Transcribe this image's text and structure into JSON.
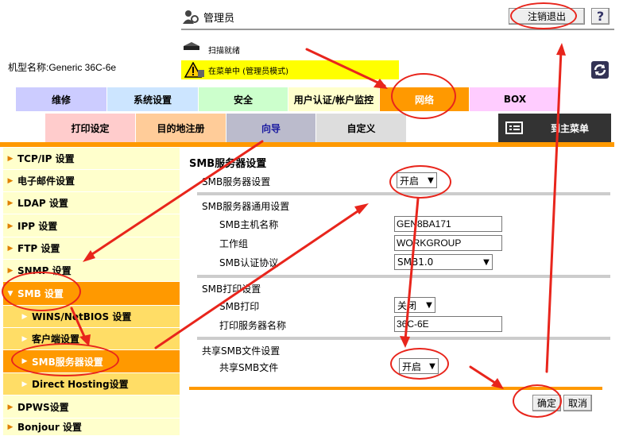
{
  "header": {
    "admin_label": "管理员",
    "scan_status": "扫描就绪",
    "model_label": "机型名称:Generic 36C-6e",
    "warning_text": "在菜单中 (管理员模式)",
    "logout_label": "注销退出",
    "help_label": "?"
  },
  "tabs": [
    {
      "label": "维修",
      "color": "#ccccff"
    },
    {
      "label": "系统设置",
      "color": "#cce5ff"
    },
    {
      "label": "安全",
      "color": "#ccffcc"
    },
    {
      "label": "用户认证/帐户监控",
      "color": "#ffffcc"
    },
    {
      "label": "网络",
      "color": "#ff9900"
    },
    {
      "label": "BOX",
      "color": "#ffccff"
    }
  ],
  "subtabs": [
    {
      "label": "打印设定",
      "color": "#ffcccc"
    },
    {
      "label": "目的地注册",
      "color": "#ffcc99"
    },
    {
      "label": "向导",
      "color": "#bbbbcc"
    },
    {
      "label": "自定义",
      "color": "#dddddd"
    },
    {
      "label": "到主菜单",
      "color": "#333333"
    }
  ],
  "sidebar": [
    {
      "label": "TCP/IP 设置"
    },
    {
      "label": "电子邮件设置"
    },
    {
      "label": "LDAP 设置"
    },
    {
      "label": "IPP 设置"
    },
    {
      "label": "FTP 设置"
    },
    {
      "label": "SNMP 设置"
    },
    {
      "label": "SMB 设置"
    },
    {
      "label": "WINS/NetBIOS 设置"
    },
    {
      "label": "客户端设置"
    },
    {
      "label": "SMB服务器设置"
    },
    {
      "label": "Direct Hosting设置"
    },
    {
      "label": "DPWS设置"
    },
    {
      "label": "Bonjour 设置"
    }
  ],
  "form": {
    "title": "SMB服务器设置",
    "server_setting_label": "SMB服务器设置",
    "server_setting_value": "开启",
    "common_section": "SMB服务器通用设置",
    "host_label": "SMB主机名称",
    "host_value": "GEN8BA171",
    "workgroup_label": "工作组",
    "workgroup_value": "WORKGROUP",
    "auth_label": "SMB认证协议",
    "auth_value": "SMB1.0",
    "print_section": "SMB打印设置",
    "print_label": "SMB打印",
    "print_value": "关闭",
    "print_server_label": "打印服务器名称",
    "print_server_value": "36C-6E",
    "share_section": "共享SMB文件设置",
    "share_label": "共享SMB文件",
    "share_value": "开启",
    "ok_label": "确定",
    "cancel_label": "取消"
  },
  "colors": {
    "accent": "#ff9900",
    "annotation": "#e8251c",
    "warning": "#ffff00"
  }
}
